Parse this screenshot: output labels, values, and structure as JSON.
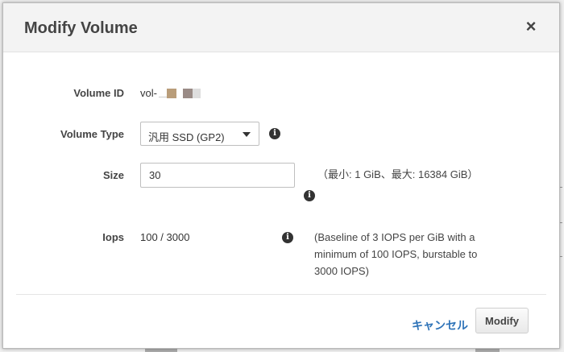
{
  "dialog": {
    "title": "Modify Volume",
    "close_label": "×"
  },
  "volume_id": {
    "label": "Volume ID",
    "prefix": "vol-",
    "redaction_colors": [
      "#b99d7a",
      "#9a8b86",
      "#dedede"
    ]
  },
  "volume_type": {
    "label": "Volume Type",
    "selected": "汎用 SSD (GP2)"
  },
  "size": {
    "label": "Size",
    "value": "30",
    "hint": "（最小: 1 GiB、最大: 16384 GiB）"
  },
  "iops": {
    "label": "Iops",
    "value": "100 / 3000",
    "hint": "(Baseline of 3 IOPS per GiB with a minimum of 100 IOPS, burstable to 3000 IOPS)"
  },
  "footer": {
    "cancel_label": "キャンセル",
    "modify_label": "Modify"
  },
  "icons": {
    "info": "info-icon",
    "close": "close-icon",
    "caret": "chevron-down-icon"
  },
  "colors": {
    "link": "#2e73b8",
    "header_bg": "#f3f3f3"
  }
}
